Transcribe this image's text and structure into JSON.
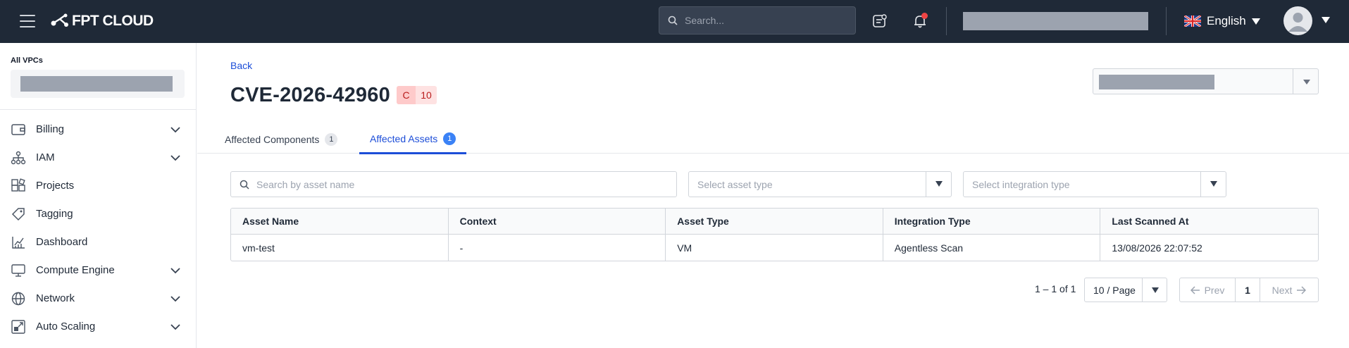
{
  "topbar": {
    "brand": "FPT CLOUD",
    "search_placeholder": "Search...",
    "language": "English"
  },
  "sidebar": {
    "vpc_label": "All VPCs",
    "items": [
      {
        "label": "Billing",
        "icon": "wallet-icon",
        "expandable": true
      },
      {
        "label": "IAM",
        "icon": "org-tree-icon",
        "expandable": true
      },
      {
        "label": "Projects",
        "icon": "blocks-icon",
        "expandable": false
      },
      {
        "label": "Tagging",
        "icon": "tag-icon",
        "expandable": false
      },
      {
        "label": "Dashboard",
        "icon": "chart-icon",
        "expandable": false
      },
      {
        "label": "Compute Engine",
        "icon": "monitor-icon",
        "expandable": true
      },
      {
        "label": "Network",
        "icon": "globe-icon",
        "expandable": true
      },
      {
        "label": "Auto Scaling",
        "icon": "scaling-icon",
        "expandable": true
      }
    ]
  },
  "main": {
    "back_label": "Back",
    "title": "CVE-2026-42960",
    "severity": "C",
    "score": "10",
    "tabs": [
      {
        "label": "Affected Components",
        "count": "1",
        "active": false
      },
      {
        "label": "Affected Assets",
        "count": "1",
        "active": true
      }
    ],
    "filters": {
      "search_placeholder": "Search by asset name",
      "asset_type_placeholder": "Select asset type",
      "integration_type_placeholder": "Select integration type"
    },
    "table": {
      "columns": [
        "Asset Name",
        "Context",
        "Asset Type",
        "Integration Type",
        "Last Scanned At"
      ],
      "rows": [
        [
          "vm-test",
          "-",
          "VM",
          "Agentless Scan",
          "13/08/2026 22:07:52"
        ]
      ]
    },
    "pagination": {
      "info": "1 – 1 of 1",
      "per_page": "10 / Page",
      "prev": "Prev",
      "current": "1",
      "next": "Next"
    }
  },
  "colors": {
    "topbar_bg": "#1f2937",
    "accent": "#1d4ed8",
    "critical_bg": "#fecaca",
    "critical_text": "#b91c1c"
  }
}
